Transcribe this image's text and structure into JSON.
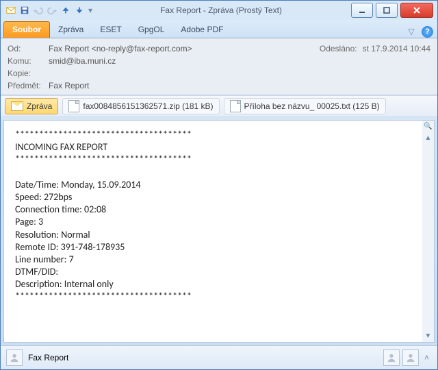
{
  "window": {
    "title": "Fax Report  -  Zpráva (Prostý Text)"
  },
  "ribbon": {
    "tabs": [
      "Soubor",
      "Zpráva",
      "ESET",
      "GpgOL",
      "Adobe PDF"
    ]
  },
  "header": {
    "labels": {
      "from": "Od:",
      "to": "Komu:",
      "cc": "Kopie:",
      "subject": "Předmět:",
      "sent": "Odesláno:"
    },
    "from": "Fax Report <no-reply@fax-report.com>",
    "to": "smid@iba.muni.cz",
    "cc": "",
    "subject": "Fax Report",
    "sent": "st 17.9.2014 10:44"
  },
  "attachments": {
    "message_tab": "Zpráva",
    "items": [
      {
        "name": "fax0084856151362571.zip (181 kB)"
      },
      {
        "name": "Příloha bez názvu_ 00025.txt (125 B)"
      }
    ]
  },
  "body_text": "*************************************\nINCOMING FAX REPORT\n*************************************\n\nDate/Time: Monday, 15.09.2014\nSpeed: 272bps\nConnection time: 02:08\nPage: 3\nResolution: Normal\nRemote ID: 391-748-178935\nLine number: 7\nDTMF/DID:\nDescription: Internal only\n*************************************",
  "bottom": {
    "sender_name": "Fax Report"
  }
}
